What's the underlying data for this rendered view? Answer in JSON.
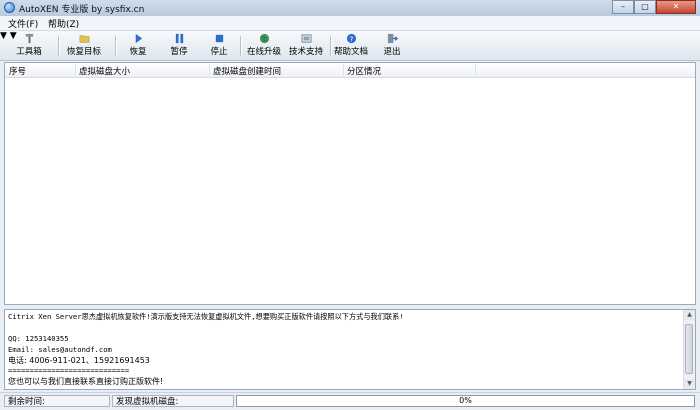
{
  "window": {
    "title": "AutoXEN 专业版 by sysfix.cn",
    "controls": [
      "minimize-icon",
      "maximize-icon",
      "close-icon"
    ]
  },
  "menu": [
    "文件(F)",
    "帮助(Z)"
  ],
  "toolbar": {
    "toolbox": "工具箱",
    "restore_target": "恢复目标",
    "restore": "恢复",
    "pause": "暂停",
    "stop": "停止",
    "online_upgrade": "在线升级",
    "tech_support": "技术支持",
    "help_docs": "帮助文档",
    "exit": "退出"
  },
  "table": {
    "columns": [
      "序号",
      "虚拟磁盘大小",
      "虚拟磁盘创建时间",
      "分区情况"
    ],
    "rows": []
  },
  "log": {
    "lines": [
      "Citrix Xen Server思杰虚拟机恢复软件!演示版支持无法恢复虚拟机文件,想要购买正版软件请按照以下方式与我们联系!",
      "",
      "QQ: 1253140355",
      "Email: sales@autondf.com",
      "电话: 4006-911-021、15921691453",
      "============================",
      "您也可以与我们直接联系直接订购正版软件!"
    ]
  },
  "status": {
    "remaining_time_label": "剩余时间:",
    "found_disk_label": "发现虚拟机磁盘:",
    "progress_percent": 0,
    "progress_text": "0%"
  },
  "colors": {
    "accent": "#3b7fd0",
    "progress_fill": "#4cb050"
  }
}
